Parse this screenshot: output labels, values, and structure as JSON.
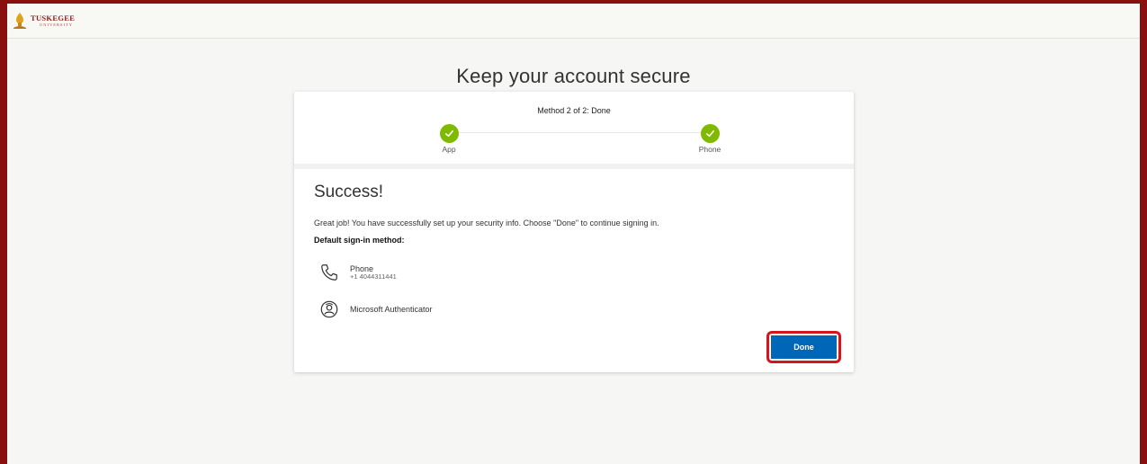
{
  "brand": {
    "name": "TUSKEGEE",
    "subtitle": "UNIVERSITY"
  },
  "page": {
    "heading": "Keep your account secure"
  },
  "progress": {
    "title": "Method 2 of 2: Done",
    "steps": [
      {
        "label": "App",
        "status": "complete",
        "icon": "checkmark-icon"
      },
      {
        "label": "Phone",
        "status": "complete",
        "icon": "checkmark-icon"
      }
    ]
  },
  "content": {
    "title": "Success!",
    "message": "Great job! You have successfully set up your security info. Choose \"Done\" to continue signing in.",
    "default_label": "Default sign-in method:",
    "methods": [
      {
        "icon": "phone-icon",
        "name": "Phone",
        "detail": "+1 4044311441"
      },
      {
        "icon": "authenticator-icon",
        "name": "Microsoft Authenticator"
      }
    ]
  },
  "actions": {
    "done_label": "Done"
  },
  "colors": {
    "frame": "#8a0f0f",
    "step_complete": "#7fba00",
    "primary_button": "#0067b8",
    "highlight": "#d6141d"
  }
}
